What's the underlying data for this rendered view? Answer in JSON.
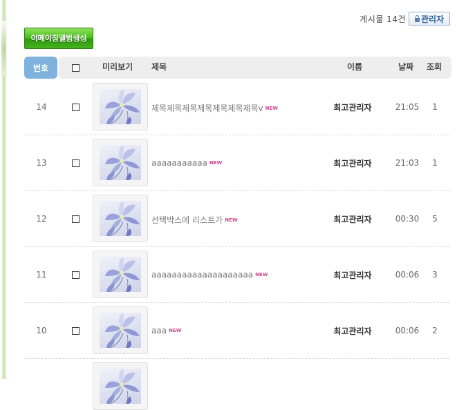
{
  "header": {
    "total_label": "게시물 14건",
    "admin_button": "관리자",
    "action_button": "이메이징앨범생성"
  },
  "table": {
    "columns": {
      "num": "번호",
      "preview": "미리보기",
      "title": "제목",
      "name": "이름",
      "date": "날짜",
      "hits": "조회"
    },
    "new_badge": "NEW",
    "rows": [
      {
        "num": "14",
        "title": "제목제목제목제목제목제목제목v",
        "name": "최고관리자",
        "date": "21:05",
        "hits": "1"
      },
      {
        "num": "13",
        "title": "aaaaaaaaaaa",
        "name": "최고관리자",
        "date": "21:03",
        "hits": "1"
      },
      {
        "num": "12",
        "title": "선택박스에 리스트가",
        "name": "최고관리자",
        "date": "00:30",
        "hits": "5"
      },
      {
        "num": "11",
        "title": "aaaaaaaaaaaaaaaaaaaa",
        "name": "최고관리자",
        "date": "00:06",
        "hits": "3"
      },
      {
        "num": "10",
        "title": "aaa",
        "name": "최고관리자",
        "date": "00:06",
        "hits": "2"
      }
    ]
  }
}
